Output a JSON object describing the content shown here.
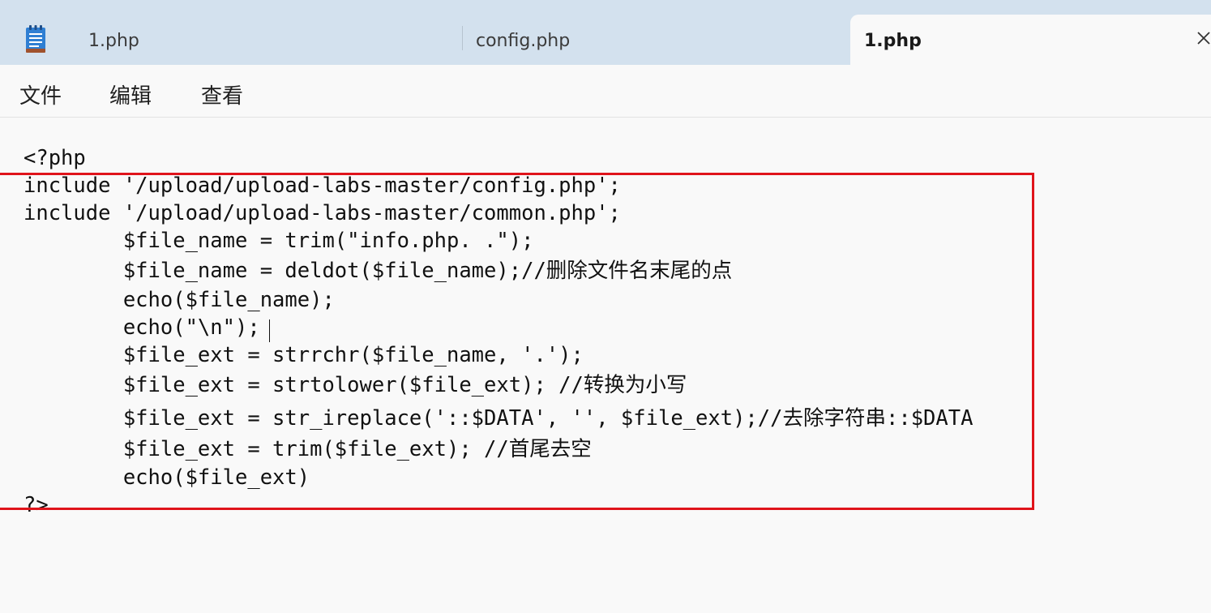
{
  "tabs": [
    {
      "label": "1.php"
    },
    {
      "label": "config.php"
    },
    {
      "label": "1.php",
      "active": true
    }
  ],
  "menu": {
    "file": "文件",
    "edit": "编辑",
    "view": "查看"
  },
  "code": {
    "lines": [
      "<?php",
      "include '/upload/upload-labs-master/config.php';",
      "include '/upload/upload-labs-master/common.php';",
      "        $file_name = trim(\"info.php. .\");",
      "        $file_name = deldot($file_name);//删除文件名末尾的点",
      "        echo($file_name);",
      "        echo(\"\\n\");",
      "        $file_ext = strrchr($file_name, '.');",
      "        $file_ext = strtolower($file_ext); //转换为小写",
      "        $file_ext = str_ireplace('::$DATA', '', $file_ext);//去除字符串::$DATA",
      "        $file_ext = trim($file_ext); //首尾去空",
      "        echo($file_ext)",
      "?>"
    ]
  },
  "colors": {
    "tab_strip": "#d3e1ee",
    "highlight": "#e0141b"
  },
  "icons": {
    "app": "notepad-icon",
    "close": "close-icon"
  }
}
